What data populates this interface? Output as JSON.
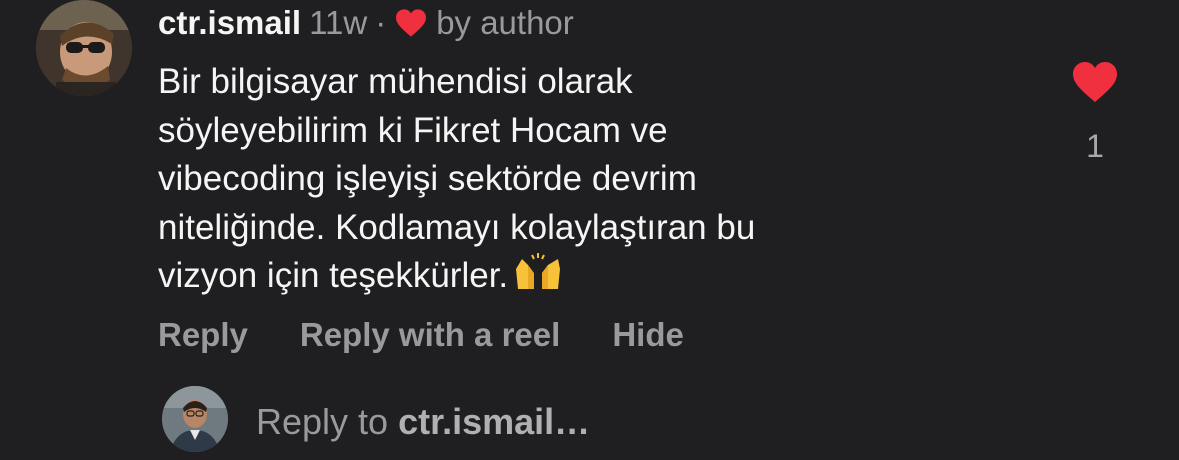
{
  "comment": {
    "username": "ctr.ismail",
    "time": "11w",
    "separator": "·",
    "liked_by": "by author",
    "lines": [
      "Bir bilgisayar mühendisi olarak",
      "söyleyebilirim ki Fikret Hocam ve",
      "vibecoding işleyişi sektörde devrim",
      "niteliğinde. Kodlamayı kolaylaştıran bu",
      "vizyon için teşekkürler."
    ],
    "emoji": "raising-hands",
    "like_count": "1",
    "actions": {
      "reply": "Reply",
      "reply_reel": "Reply with a reel",
      "hide": "Hide"
    }
  },
  "reply_box": {
    "prefix": "Reply to",
    "target": "ctr.ismail…"
  },
  "colors": {
    "background": "#1f1f21",
    "heart": "#f0303f",
    "muted": "#9a9a9e"
  }
}
